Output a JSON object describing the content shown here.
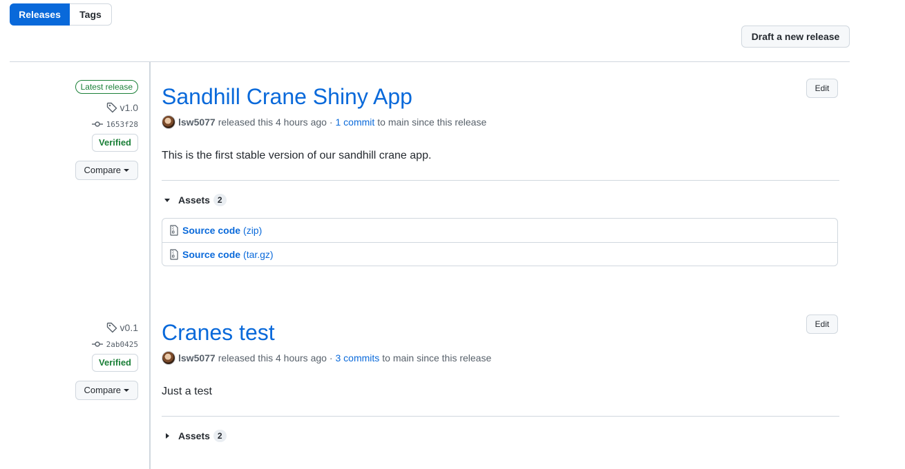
{
  "tabs": {
    "releases": "Releases",
    "tags": "Tags"
  },
  "draft_button": "Draft a new release",
  "releases": [
    {
      "badge": "Latest release",
      "tag": "v1.0",
      "commit": "1653f28",
      "verified": "Verified",
      "compare": "Compare",
      "title": "Sandhill Crane Shiny App",
      "edit": "Edit",
      "author": "lsw5077",
      "released_text": "released this 4 hours ago ·",
      "commits_link": "1 commit",
      "since_text": "to main since this release",
      "description": "This is the first stable version of our sandhill crane app.",
      "assets_label": "Assets",
      "assets_count": "2",
      "assets_expanded": true,
      "assets": [
        {
          "name": "Source code",
          "ext": "(zip)"
        },
        {
          "name": "Source code",
          "ext": "(tar.gz)"
        }
      ]
    },
    {
      "tag": "v0.1",
      "commit": "2ab0425",
      "verified": "Verified",
      "compare": "Compare",
      "title": "Cranes test",
      "edit": "Edit",
      "author": "lsw5077",
      "released_text": "released this 4 hours ago ·",
      "commits_link": "3 commits",
      "since_text": "to main since this release",
      "description": "Just a test",
      "assets_label": "Assets",
      "assets_count": "2",
      "assets_expanded": false
    }
  ],
  "icons": {
    "tag": "tag-icon",
    "commit": "git-commit-icon",
    "file_zip": "file-zip-icon",
    "caret": "triangle-icon"
  }
}
